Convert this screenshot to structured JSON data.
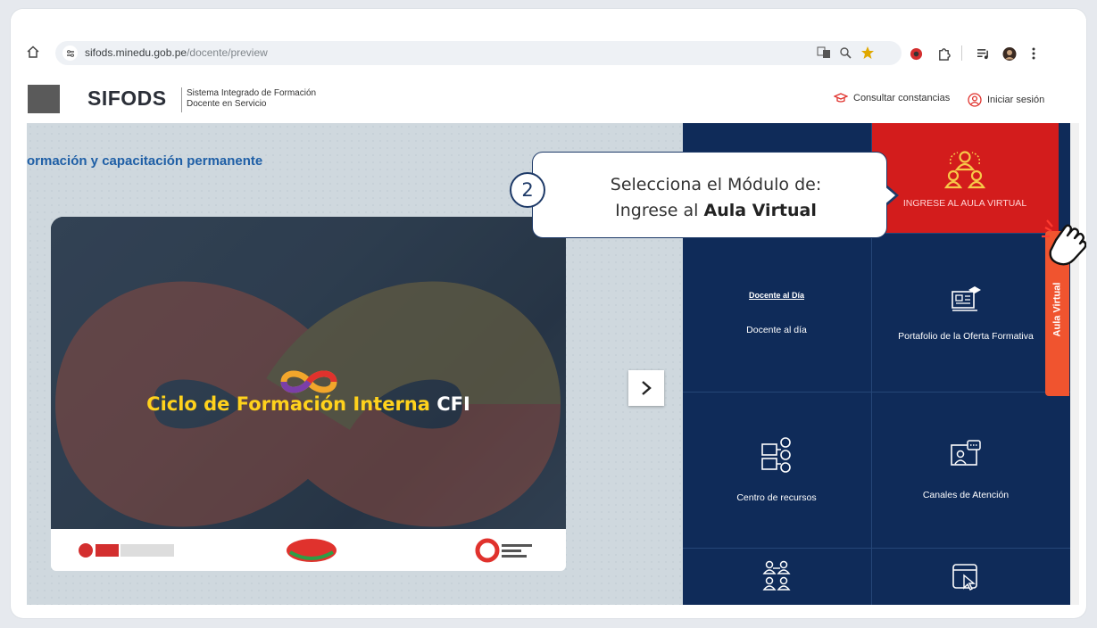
{
  "browser": {
    "url_host": "sifods.minedu.gob.pe",
    "url_path": "/docente/preview",
    "icons": [
      "home-icon",
      "site-info-icon",
      "translate-icon",
      "zoom-icon",
      "bookmark-star-icon",
      "extension-icon",
      "puzzle-icon",
      "media-icon",
      "profile-icon",
      "menu-icon"
    ]
  },
  "header": {
    "brand": "SIFODS",
    "subtitle_line1": "Sistema Integrado de Formación",
    "subtitle_line2": "Docente en Servicio",
    "consultar": "Consultar constancias",
    "login": "Iniciar sesión"
  },
  "banner": {
    "title": "ormación y capacitación permanente",
    "promo_text_yellow": "Ciclo de Formación Interna",
    "promo_text_white": "CFI"
  },
  "tiles": [
    {
      "label": "INGRESE AL AULA VIRTUAL",
      "icon": "group-icon"
    },
    {
      "label": "Docente al día",
      "icon": "docente-al-dia-logo"
    },
    {
      "label": "Portafolio de la Oferta Formativa",
      "icon": "portfolio-icon"
    },
    {
      "label": "Centro de recursos",
      "icon": "resources-icon"
    },
    {
      "label": "Canales de Atención",
      "icon": "support-icon"
    }
  ],
  "docente_logo_text": "Docente al Día",
  "side_tab": "Aula Virtual",
  "callout": {
    "step": "2",
    "line1": "Selecciona el Módulo de:",
    "line2_prefix": "Ingrese al",
    "line2_bold": "Aula Virtual"
  },
  "colors": {
    "tile_bg": "#0f2b59",
    "accent_red": "#d31c1c",
    "side_tab": "#f0542f",
    "brand_blue": "#1f5fa6"
  }
}
